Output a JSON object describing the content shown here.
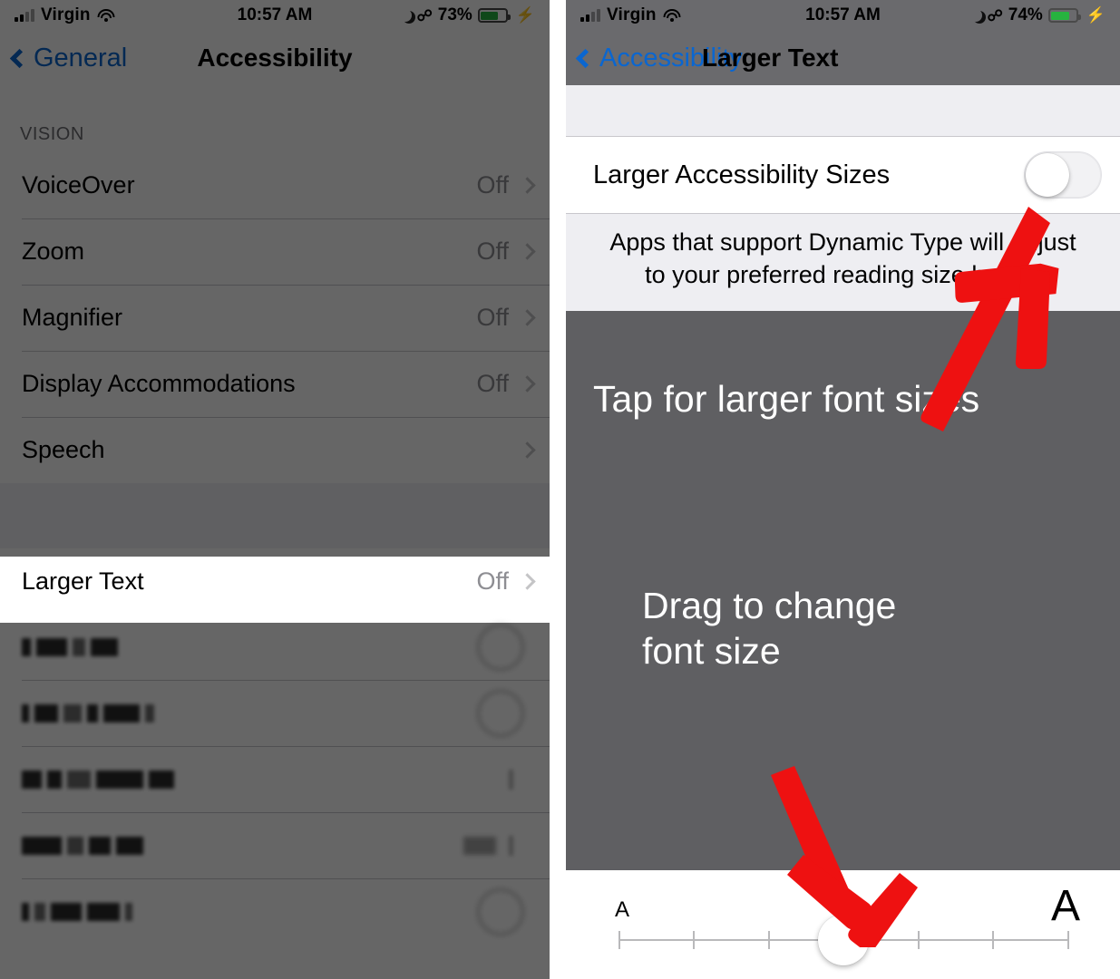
{
  "left_phone": {
    "status_bar": {
      "carrier": "Virgin",
      "time": "10:57 AM",
      "battery_percent": "73%",
      "signal_icon": "signal-bars-icon",
      "wifi_icon": "wifi-icon",
      "dnd_icon": "moon-icon",
      "bluetooth_icon": "bluetooth-icon",
      "battery_icon": "battery-icon",
      "charging_icon": "lightning-bolt-icon"
    },
    "nav": {
      "back_label": "General",
      "title": "Accessibility",
      "back_icon": "chevron-left-icon"
    },
    "section_header": "VISION",
    "rows": [
      {
        "label": "VoiceOver",
        "value": "Off",
        "chevron": "chevron-right-icon"
      },
      {
        "label": "Zoom",
        "value": "Off",
        "chevron": "chevron-right-icon"
      },
      {
        "label": "Magnifier",
        "value": "Off",
        "chevron": "chevron-right-icon"
      },
      {
        "label": "Display Accommodations",
        "value": "Off",
        "chevron": "chevron-right-icon"
      },
      {
        "label": "Speech",
        "value": "",
        "chevron": "chevron-right-icon"
      }
    ],
    "highlighted_row": {
      "label": "Larger Text",
      "value": "Off",
      "chevron": "chevron-right-icon"
    },
    "obscured_rows": [
      {
        "label": "",
        "accessory": "blurred-circle"
      },
      {
        "label": "",
        "accessory": "blurred-circle"
      },
      {
        "label": "",
        "accessory": "blurred-chevron"
      },
      {
        "label": "",
        "accessory": "blurred-value"
      },
      {
        "label": "",
        "accessory": "blurred-circle"
      }
    ]
  },
  "right_phone": {
    "status_bar": {
      "carrier": "Virgin",
      "time": "10:57 AM",
      "battery_percent": "74%",
      "signal_icon": "signal-bars-icon",
      "wifi_icon": "wifi-icon",
      "dnd_icon": "moon-icon",
      "bluetooth_icon": "bluetooth-icon",
      "battery_icon": "battery-icon",
      "charging_icon": "lightning-bolt-icon"
    },
    "nav": {
      "back_label": "Accessibility",
      "title": "Larger Text",
      "back_icon": "chevron-left-icon"
    },
    "toggle_row": {
      "label": "Larger Accessibility Sizes",
      "state": "off"
    },
    "helper_text": "Apps that support Dynamic Type will adjust to your preferred reading size below.",
    "slider": {
      "small_a": "A",
      "large_a": "A",
      "ticks": 7,
      "selected_index": 3
    }
  },
  "annotations": {
    "accent_color": "#ee1111",
    "callout_tap": "Tap for larger font sizes",
    "callout_drag_line1": "Drag to change",
    "callout_drag_line2": "font size",
    "arrow_to_toggle": "arrow-up-right-icon",
    "arrow_to_slider": "arrow-down-icon"
  }
}
